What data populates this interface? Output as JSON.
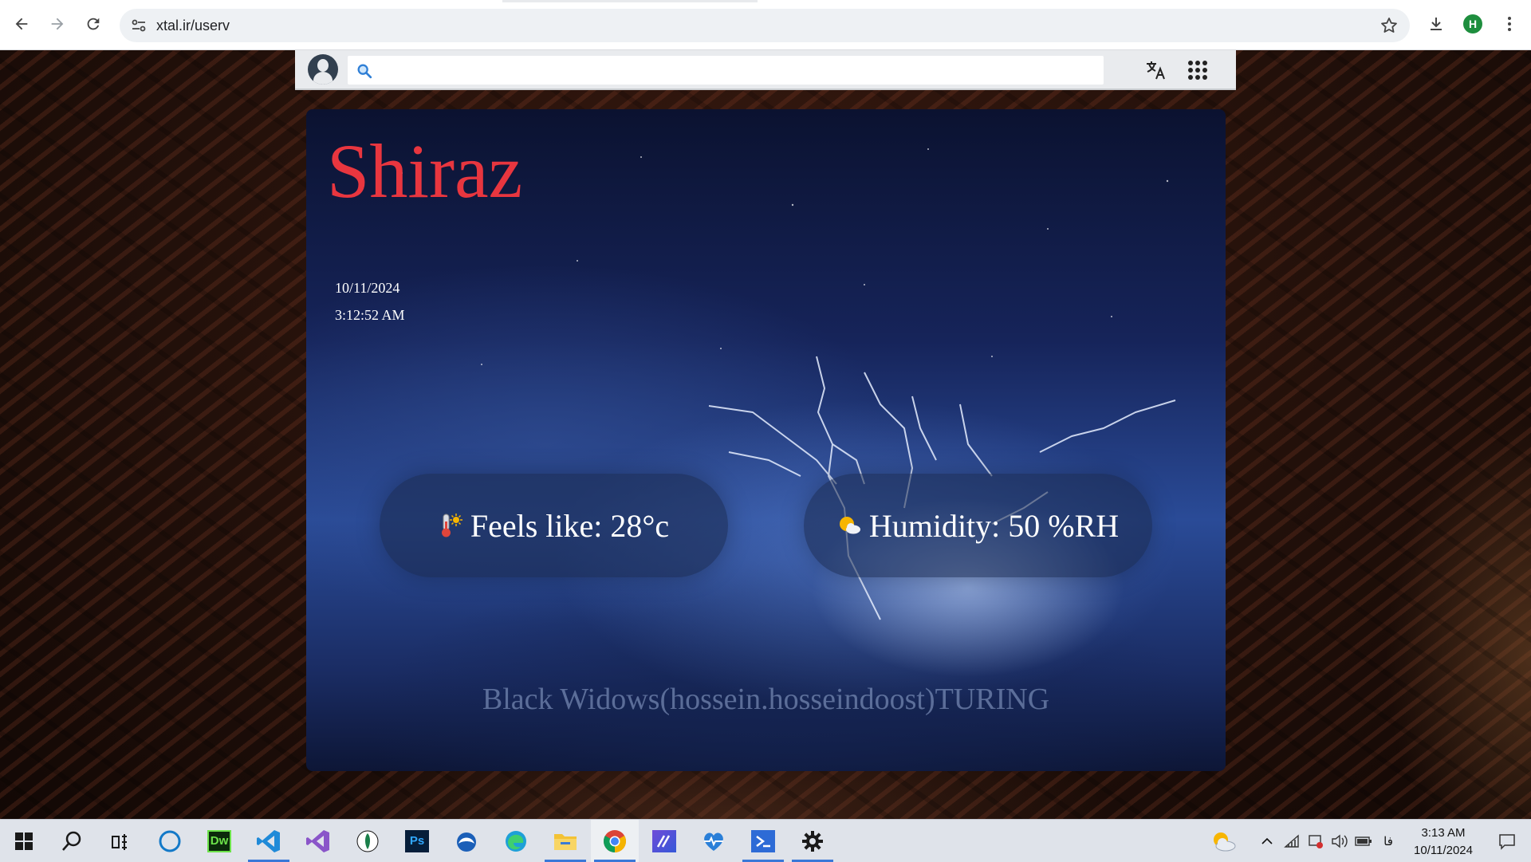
{
  "browser": {
    "url": "xtal.ir/userv",
    "profile_initial": "H",
    "icons": [
      "back-icon",
      "forward-icon",
      "reload-icon",
      "site-settings-icon",
      "star-icon",
      "download-icon",
      "more-menu-icon"
    ]
  },
  "site": {
    "search": {
      "placeholder": ""
    },
    "icons": [
      "avatar-icon",
      "search-icon",
      "translate-icon",
      "apps-grid-icon"
    ]
  },
  "weather": {
    "city": "Shiraz",
    "date": "10/11/2024",
    "time": "3:12:52 AM",
    "feels_like": "Feels like: 28°c",
    "humidity": "Humidity: 50 %RH",
    "credit": "Black Widows(hossein.hosseindoost)TURING",
    "colors": {
      "city": "#e8363f"
    }
  },
  "taskbar": {
    "apps": [
      "start-icon",
      "search-icon",
      "task-view-icon",
      "cortana-icon",
      "dreamweaver-icon",
      "vscode-icon",
      "visual-studio-icon",
      "app-icon",
      "photoshop-icon",
      "browser-icon",
      "edge-icon",
      "file-explorer-icon",
      "chrome-icon",
      "app-icon",
      "health-icon",
      "terminal-icon",
      "settings-icon"
    ],
    "dreamweaver_label": "Dw",
    "photoshop_label": "Ps",
    "language": "فا",
    "clock_time": "3:13 AM",
    "clock_date": "10/11/2024"
  }
}
